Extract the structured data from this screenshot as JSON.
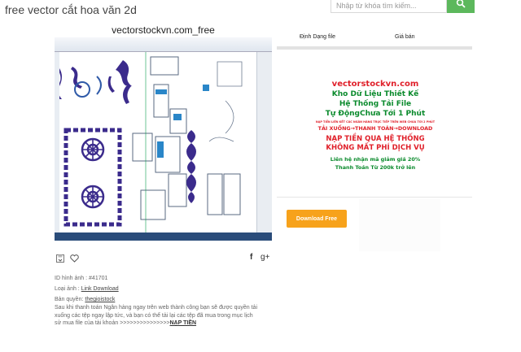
{
  "header": {
    "title": "free vector cắt hoa văn 2d",
    "search_placeholder": "Nhập từ khóa tìm kiếm...",
    "search_icon": "search-icon"
  },
  "preview": {
    "banner": "vectorstockvn.com_free"
  },
  "actions": {
    "save_icon": "save-icon",
    "like_icon": "heart-icon",
    "facebook_icon": "f",
    "google_plus_icon": "g+"
  },
  "meta": {
    "id_text": "ID hình ảnh : #41701",
    "type_label": "Loại ảnh : ",
    "type_link": "Link Download",
    "copyright_label": "Bản quyền: ",
    "copyright_link": "thegioistock",
    "description_line1": "Sau khi thanh toán Ngân hàng ngay trên web thành công bạn sẽ được quyền tải",
    "description_line2": "xuống các tệp ngay lập tức, và bạn có thể tải lại các tệp đã mua trong mục lịch",
    "description_line3_prefix": "sử mua file của tài khoản >>>>>>>>>>>>>>>",
    "description_link": "NẠP TIỀN"
  },
  "sidebar": {
    "tabs": [
      "Định Dạng file",
      "Giá bán"
    ],
    "ad": {
      "line1": "vectorstockvn.com",
      "line2": "Kho Dữ Liệu Thiết Kế",
      "line3": "Hệ Thống Tải File",
      "line4": "Tự ĐộngChưa Tới 1 Phút",
      "line5": "NẠP TIỀN LIÊN KẾT CÁC NGÂN HÀNG TRỰC TIẾP TRÊN WEB CHƯA TỚI 2 PHÚT",
      "line6": "TẢI XUỐNG→THANH TOÁN→DOWNLOAD",
      "line7": "NẠP TIỀN QUA HỆ THỐNG",
      "line8": "KHÔNG MẤT PHÍ DỊCH VỤ",
      "line9": "Liên hệ nhận mã giảm giá 20%",
      "line10": "Thanh Toán Từ 200k trở lên"
    },
    "download_label": "Download Free"
  },
  "colors": {
    "accent_green": "#5cb85c",
    "download_orange": "#f7a21b",
    "ad_red": "#e0202a",
    "ad_green": "#0a8a2c",
    "ornament_purple": "#3b2b8c"
  }
}
